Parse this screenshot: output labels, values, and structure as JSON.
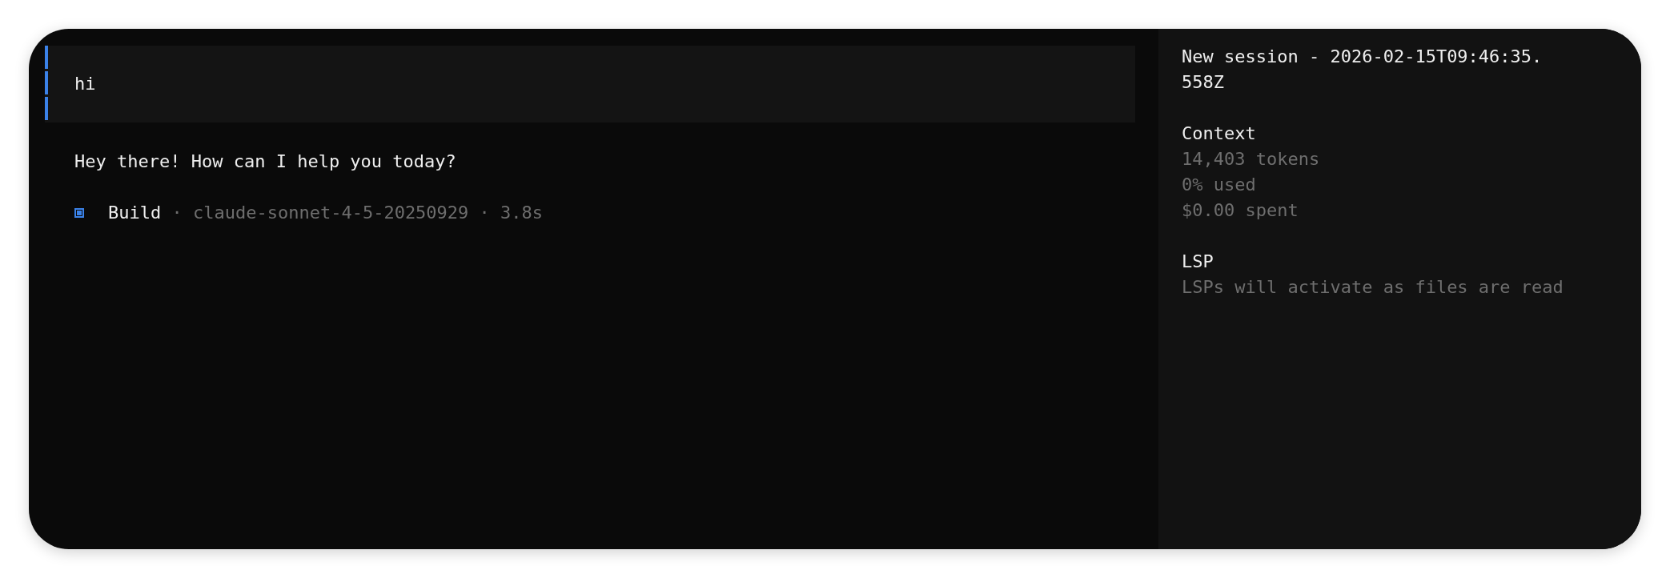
{
  "conversation": {
    "user_message": {
      "text": "hi"
    },
    "assistant_message": {
      "text": "Hey there! How can I help you today?"
    },
    "status_line": {
      "agent": "Build",
      "details": "· claude-sonnet-4-5-20250929 · 3.8s"
    }
  },
  "sidebar": {
    "title": "New session - 2026-02-15T09:46:35.558Z",
    "sections": [
      {
        "heading": "Context",
        "lines": [
          "14,403 tokens",
          "0% used",
          "$0.00 spent"
        ]
      },
      {
        "heading": "LSP",
        "lines": [
          "LSPs will activate as files are read"
        ]
      }
    ]
  }
}
